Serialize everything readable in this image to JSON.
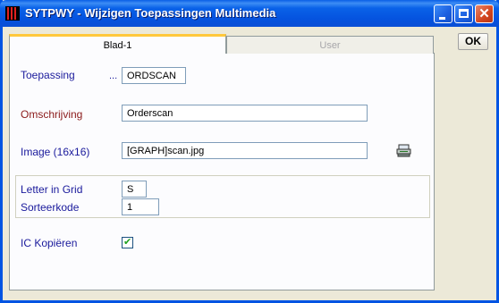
{
  "window": {
    "title": "SYTPWY - Wijzigen Toepassingen Multimedia",
    "accent_color": "#0054e3",
    "close_glyph": "✕"
  },
  "tabs": [
    {
      "label": "Blad-1",
      "active": true
    },
    {
      "label": "User",
      "active": false
    }
  ],
  "form": {
    "toepassing": {
      "label": "Toepassing",
      "dots": "...",
      "value": "ORDSCAN"
    },
    "omschrijving": {
      "label": "Omschrijving",
      "value": "Orderscan"
    },
    "image": {
      "label": "Image (16x16)",
      "value": "[GRAPH]scan.jpg",
      "icon": "scanner-icon"
    },
    "letter_in_grid": {
      "label": "Letter in Grid",
      "value": "S"
    },
    "sorteerkode": {
      "label": "Sorteerkode",
      "value": "1"
    },
    "ic_kopieren": {
      "label": "IC Kopiëren",
      "checked": true,
      "check_glyph": "✔"
    }
  },
  "buttons": {
    "ok": "OK"
  }
}
